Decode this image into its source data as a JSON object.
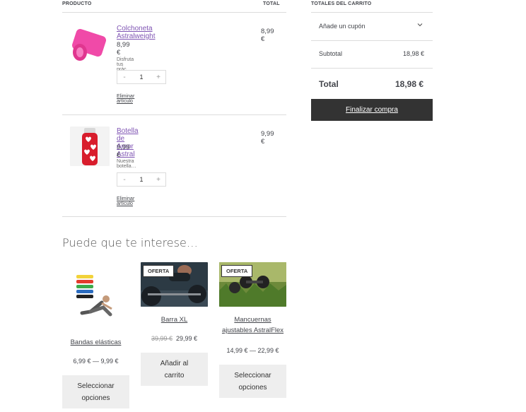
{
  "cart_table": {
    "header_product": "PRODUCTO",
    "header_total": "TOTAL",
    "items": [
      {
        "name": "Colchoneta Astralweight",
        "unit_price": "8,99 €",
        "description": "Disfruta tus prác…",
        "quantity": "1",
        "minus": "-",
        "plus": "+",
        "remove_label": "Eliminar artículo",
        "line_total": "8,99 €",
        "image_icon": "yoga-mat-image"
      },
      {
        "name": "Botella de Amor Astral",
        "unit_price": "9,99 €",
        "description": "Nuestra botella…",
        "quantity": "1",
        "minus": "-",
        "plus": "+",
        "remove_label": "Eliminar artículo",
        "line_total": "9,99 €",
        "image_icon": "heart-bottle-image"
      }
    ]
  },
  "totals": {
    "header": "TOTALES DEL CARRITO",
    "coupon_label": "Añade un cupón",
    "subtotal_label": "Subtotal",
    "subtotal_value": "18,98 €",
    "total_label": "Total",
    "total_value": "18,98 €",
    "checkout_label": "Finalizar compra"
  },
  "cross_sells": {
    "title": "Puede que te interese…",
    "products": [
      {
        "name": "Bandas elásticas",
        "price": "6,99 € — 9,99 €",
        "button": "Seleccionar opciones",
        "image_icon": "resistance-bands-image"
      },
      {
        "name": "Barra XL",
        "badge": "OFERTA",
        "old_price": "39,99 €",
        "price": "29,99 €",
        "button": "Añadir al carrito",
        "image_icon": "barbell-image"
      },
      {
        "name": "Mancuernas ajustables AstralFlex",
        "badge": "OFERTA",
        "price": "14,99 € — 22,99 €",
        "button": "Seleccionar opciones",
        "image_icon": "dumbbells-image"
      }
    ]
  },
  "colors": {
    "accent": "#7f54b3",
    "checkout_bg": "#333333",
    "button_bg": "#eeeeee"
  }
}
